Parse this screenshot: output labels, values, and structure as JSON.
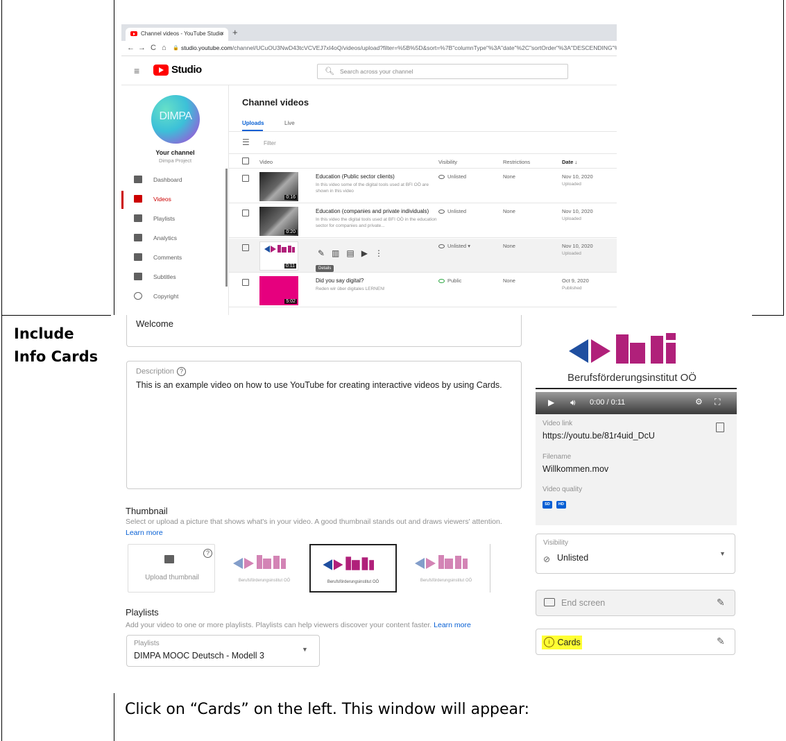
{
  "document": {
    "row_label": "Include Info Cards",
    "caption": "Click on “Cards” on the left. This window will appear:"
  },
  "studio": {
    "browser": {
      "tab_title": "Channel videos - YouTube Studio",
      "tab_close": "×",
      "new_tab": "+",
      "nav_glyphs": [
        "←",
        "→",
        "C",
        "⌂",
        "🔒"
      ],
      "url_host": "studio.youtube.com",
      "url_path": "/channel/UCuOU3NwD43tcVCVEJ7xl4oQ/videos/upload?filter=%5B%5D&sort=%7B\"columnType\"%3A\"date\"%2C\"sortOrder\"%3A\"DESCENDING\"%"
    },
    "header": {
      "app_name": "Studio",
      "search_placeholder": "Search across your channel"
    },
    "sidebar": {
      "avatar_text": "DIMPA",
      "channel_title": "Your channel",
      "channel_name": "Dimpa Project",
      "items": [
        {
          "label": "Dashboard",
          "icon": "dashboard-icon",
          "active": false
        },
        {
          "label": "Videos",
          "icon": "videos-icon",
          "active": true
        },
        {
          "label": "Playlists",
          "icon": "playlists-icon",
          "active": false
        },
        {
          "label": "Analytics",
          "icon": "analytics-icon",
          "active": false
        },
        {
          "label": "Comments",
          "icon": "comments-icon",
          "active": false
        },
        {
          "label": "Subtitles",
          "icon": "subtitles-icon",
          "active": false
        },
        {
          "label": "Copyright",
          "icon": "copyright-icon",
          "active": false
        }
      ]
    },
    "main": {
      "title": "Channel videos",
      "tabs": [
        "Uploads",
        "Live"
      ],
      "filter_label": "Filter",
      "columns": [
        "Video",
        "Visibility",
        "Restrictions",
        "Date ↓"
      ],
      "details_tooltip": "Details",
      "videos": [
        {
          "title": "Education (Public sector clients)",
          "description": "In this video some of the digital tools used at BFI OÖ are shown in this video",
          "duration": "0:16",
          "visibility": "Unlisted",
          "restrictions": "None",
          "date": "Nov 10, 2020",
          "status": "Uploaded"
        },
        {
          "title": "Education (companies and private individuals)",
          "description": "In this video the digital tools used at BFI OÖ in the education sector for companies and private...",
          "duration": "0:20",
          "visibility": "Unlisted",
          "restrictions": "None",
          "date": "Nov 10, 2020",
          "status": "Uploaded"
        },
        {
          "title": "",
          "description": "",
          "duration": "0:11",
          "visibility": "Unlisted",
          "restrictions": "None",
          "date": "Nov 10, 2020",
          "status": "Uploaded"
        },
        {
          "title": "Did you say digital?",
          "description": "Reden wir über digitales LERNEN!",
          "duration": "5:02",
          "visibility": "Public",
          "restrictions": "None",
          "date": "Oct 9, 2020",
          "status": "Published"
        }
      ]
    }
  },
  "edit": {
    "title_value": "Welcome",
    "description_label": "Description",
    "description_value": "This is an example video on how to use YouTube for creating interactive videos by using Cards.",
    "thumbnail": {
      "title": "Thumbnail",
      "desc": "Select or upload a picture that shows what's in your video. A good thumbnail stands out and draws viewers' attention.",
      "learn_more": "Learn more",
      "upload_label": "Upload thumbnail",
      "bfi_caption": "Berufsförderungsinstitut OÖ"
    },
    "playlists": {
      "title": "Playlists",
      "desc": "Add your video to one or more playlists. Playlists can help viewers discover your content faster.",
      "learn_more": "Learn more",
      "field_label": "Playlists",
      "field_value": "DIMPA MOOC Deutsch - Modell 3"
    },
    "player": {
      "logo_caption": "Berufsförderungsinstitut OÖ",
      "time": "0:00 / 0:11",
      "video_link_label": "Video link",
      "video_link": "https://youtu.be/81r4uid_DcU",
      "filename_label": "Filename",
      "filename": "Willkommen.mov",
      "quality_label": "Video quality",
      "quality_badges": [
        "SD",
        "HD"
      ]
    },
    "visibility": {
      "label": "Visibility",
      "value": "Unlisted"
    },
    "end_screen": "End screen",
    "cards": "Cards",
    "colors": {
      "bfi_blue": "#1f4fa0",
      "bfi_magenta": "#b0207a",
      "highlight": "#ffff33",
      "youtube_red": "#ff0000"
    }
  }
}
